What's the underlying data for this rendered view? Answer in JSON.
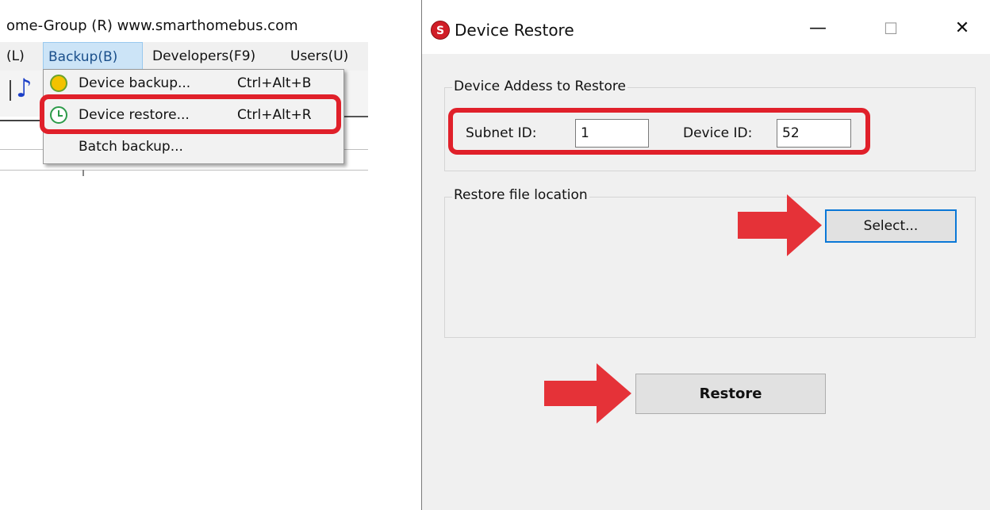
{
  "main_window": {
    "title": "ome-Group (R)  www.smarthomebus.com",
    "menubar": {
      "items": [
        {
          "label": "(L)"
        },
        {
          "label": "Backup(B)"
        },
        {
          "label": "Developers(F9)"
        },
        {
          "label": "Users(U)"
        }
      ]
    },
    "toolbar": {
      "icons": [
        "music-note-icon"
      ]
    },
    "backup_menu": {
      "items": [
        {
          "label": "Device backup...",
          "shortcut": "Ctrl+Alt+B",
          "icon": "backup-clock-icon"
        },
        {
          "label": "Device restore...",
          "shortcut": "Ctrl+Alt+R",
          "icon": "restore-clock-icon"
        },
        {
          "label": "Batch backup...",
          "shortcut": ""
        }
      ]
    }
  },
  "dialog": {
    "title": "Device Restore",
    "logo_text": "S",
    "window_controls": {
      "minimize": "—",
      "maximize": "☐",
      "close": "✕"
    },
    "address_group": {
      "legend": "Device Addess to Restore",
      "subnet_label": "Subnet ID:",
      "subnet_value": "1",
      "device_label": "Device ID:",
      "device_value": "52"
    },
    "file_group": {
      "legend": "Restore file location",
      "select_button": "Select..."
    },
    "restore_button": "Restore"
  },
  "annotation_colors": {
    "highlight": "#e0202a",
    "arrow": "#e53238"
  }
}
